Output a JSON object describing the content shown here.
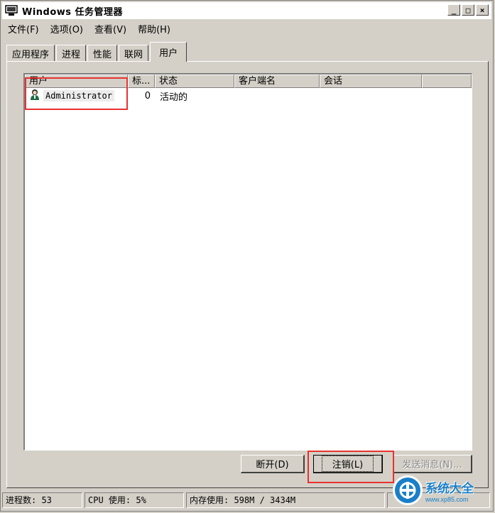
{
  "window": {
    "title": "Windows 任务管理器",
    "controls": {
      "minimize": "_",
      "maximize": "□",
      "close": "×"
    }
  },
  "menu": [
    {
      "label": "文件(F)"
    },
    {
      "label": "选项(O)"
    },
    {
      "label": "查看(V)"
    },
    {
      "label": "帮助(H)"
    }
  ],
  "tabs": [
    {
      "label": "应用程序"
    },
    {
      "label": "进程"
    },
    {
      "label": "性能"
    },
    {
      "label": "联网"
    },
    {
      "label": "用户"
    }
  ],
  "active_tab": "用户",
  "users_table": {
    "columns": [
      "用户",
      "标...",
      "状态",
      "客户端名",
      "会话"
    ],
    "rows": [
      {
        "user": "Administrator",
        "id": "0",
        "status": "活动的",
        "client": "",
        "session": ""
      }
    ]
  },
  "buttons": {
    "disconnect": "断开(D)",
    "logoff": "注销(L)",
    "send_message": "发送消息(N)..."
  },
  "statusbar": {
    "processes": "进程数: 53",
    "cpu": "CPU 使用: 5%",
    "memory": "内存使用: 598M / 3434M"
  },
  "watermark": {
    "title": "系统大全",
    "url": "www.xp85.com"
  },
  "colors": {
    "highlight": "#e8322f",
    "face": "#d4d0c8",
    "watermark_blue": "#1a7fc8"
  }
}
